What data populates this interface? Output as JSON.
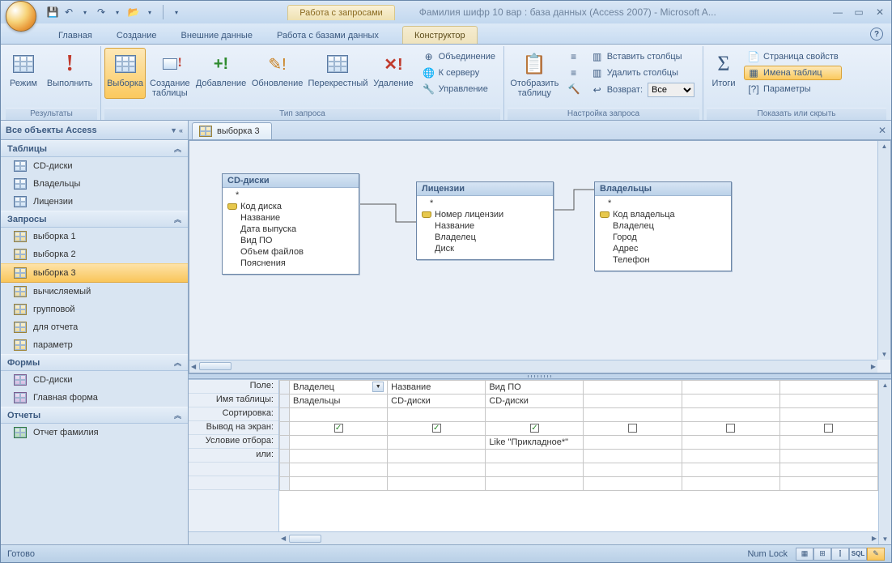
{
  "titlebar": {
    "context_tab_title": "Работа с запросами",
    "window_title": "Фамилия шифр 10 вар : база данных (Access 2007) - Microsoft A..."
  },
  "tabs": {
    "home": "Главная",
    "create": "Создание",
    "external": "Внешние данные",
    "dbtools": "Работа с базами данных",
    "design": "Конструктор"
  },
  "ribbon": {
    "results": {
      "label": "Результаты",
      "view": "Режим",
      "run": "Выполнить"
    },
    "querytype": {
      "label": "Тип запроса",
      "select": "Выборка",
      "maketable": "Создание\nтаблицы",
      "append": "Добавление",
      "update": "Обновление",
      "crosstab": "Перекрестный",
      "delete": "Удаление",
      "union": "Объединение",
      "passthrough": "К серверу",
      "datadef": "Управление"
    },
    "querysetup": {
      "label": "Настройка запроса",
      "showtable": "Отобразить\nтаблицу",
      "insertcols": "Вставить столбцы",
      "deletecols": "Удалить столбцы",
      "return": "Возврат:",
      "return_val": "Все"
    },
    "showhide": {
      "label": "Показать или скрыть",
      "totals": "Итоги",
      "propsheet": "Страница свойств",
      "tablenames": "Имена таблиц",
      "params": "Параметры"
    }
  },
  "nav": {
    "header": "Все объекты Access",
    "cat_tables": "Таблицы",
    "tables": [
      "CD-диски",
      "Владельцы",
      "Лицензии"
    ],
    "cat_queries": "Запросы",
    "queries": [
      "выборка 1",
      "выборка 2",
      "выборка 3",
      "вычисляемый",
      "групповой",
      "для отчета",
      "параметр"
    ],
    "selected_query": "выборка 3",
    "cat_forms": "Формы",
    "forms": [
      "CD-диски",
      "Главная форма"
    ],
    "cat_reports": "Отчеты",
    "reports": [
      "Отчет фамилия"
    ]
  },
  "doc_tab": "выборка 3",
  "diagram": {
    "t1": {
      "title": "CD-диски",
      "fields": [
        "*",
        "Код диска",
        "Название",
        "Дата выпуска",
        "Вид ПО",
        "Объем файлов",
        "Пояснения"
      ],
      "pk_index": 1
    },
    "t2": {
      "title": "Лицензии",
      "fields": [
        "*",
        "Номер лицензии",
        "Название",
        "Владелец",
        "Диск"
      ],
      "pk_index": 1
    },
    "t3": {
      "title": "Владельцы",
      "fields": [
        "*",
        "Код владельца",
        "Владелец",
        "Город",
        "Адрес",
        "Телефон"
      ],
      "pk_index": 1
    }
  },
  "grid": {
    "rows": {
      "field": "Поле:",
      "table": "Имя таблицы:",
      "sort": "Сортировка:",
      "show": "Вывод на экран:",
      "criteria": "Условие отбора:",
      "or": "или:"
    },
    "cols": [
      {
        "field": "Владелец",
        "table": "Владельцы",
        "show": true,
        "criteria": "",
        "dropdown": true
      },
      {
        "field": "Название",
        "table": "CD-диски",
        "show": true,
        "criteria": ""
      },
      {
        "field": "Вид ПО",
        "table": "CD-диски",
        "show": true,
        "criteria": "Like \"Прикладное*\""
      },
      {
        "field": "",
        "table": "",
        "show": false,
        "criteria": ""
      },
      {
        "field": "",
        "table": "",
        "show": false,
        "criteria": ""
      },
      {
        "field": "",
        "table": "",
        "show": false,
        "criteria": ""
      }
    ]
  },
  "status": {
    "ready": "Готово",
    "numlock": "Num Lock",
    "sql": "SQL"
  }
}
